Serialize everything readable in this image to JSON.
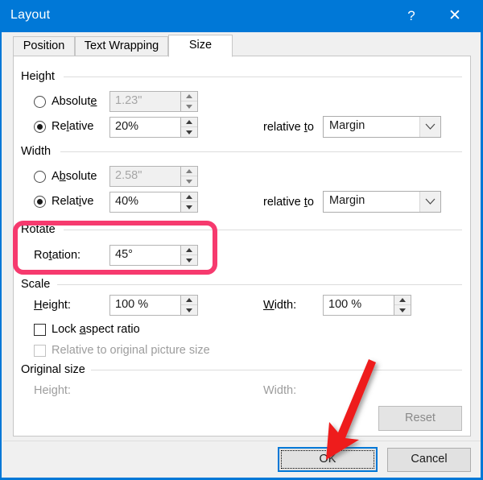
{
  "window": {
    "title": "Layout",
    "help_button": "?",
    "close_button": "✕",
    "accent_color": "#0078d7"
  },
  "tabs": [
    {
      "label": "Position",
      "active": false
    },
    {
      "label": "Text Wrapping",
      "active": false
    },
    {
      "label": "Size",
      "active": true
    }
  ],
  "size_tab": {
    "height_group": {
      "title": "Height",
      "absolute": {
        "label_pre": "Absolut",
        "label_accel": "e",
        "label_post": "",
        "selected": false,
        "value": "1.23\"",
        "enabled": false
      },
      "relative": {
        "label_pre": "Re",
        "label_accel": "l",
        "label_post": "ative",
        "selected": true,
        "value": "20%",
        "enabled": true
      },
      "relative_to_label_pre": "relative ",
      "relative_to_label_accel": "t",
      "relative_to_label_post": "o",
      "relative_to_value": "Margin"
    },
    "width_group": {
      "title": "Width",
      "absolute": {
        "label_pre": "A",
        "label_accel": "b",
        "label_post": "solute",
        "selected": false,
        "value": "2.58\"",
        "enabled": false
      },
      "relative": {
        "label_pre": "Relat",
        "label_accel": "i",
        "label_post": "ve",
        "selected": true,
        "value": "40%",
        "enabled": true
      },
      "relative_to_label_pre": "relative ",
      "relative_to_label_accel": "t",
      "relative_to_label_post": "o",
      "relative_to_value": "Margin"
    },
    "rotate_group": {
      "title": "Rotate",
      "rotation_label_pre": "Ro",
      "rotation_label_accel": "t",
      "rotation_label_post": "ation:",
      "rotation_value": "45°",
      "highlighted": true,
      "highlight_color": "#f63a6e"
    },
    "scale_group": {
      "title": "Scale",
      "height_label_accel": "H",
      "height_label_post": "eight:",
      "height_value": "100 %",
      "width_label_accel": "W",
      "width_label_post": "idth:",
      "width_value": "100 %",
      "lock_aspect": {
        "label_pre": "Lock ",
        "label_accel": "a",
        "label_post": "spect ratio",
        "checked": false,
        "enabled": true
      },
      "relative_original": {
        "label": "Relative to original picture size",
        "checked": false,
        "enabled": false
      }
    },
    "original_size_group": {
      "title": "Original size",
      "height_label": "Height:",
      "height_value": "",
      "width_label": "Width:",
      "width_value": ""
    },
    "reset_button": {
      "label": "Reset",
      "enabled": false
    }
  },
  "footer": {
    "ok_button": {
      "label": "OK",
      "is_default": true,
      "focused": true
    },
    "cancel_button": {
      "label": "Cancel"
    }
  },
  "annotations": {
    "arrow_color": "#ee1c1c",
    "arrow_target": "ok-button"
  }
}
